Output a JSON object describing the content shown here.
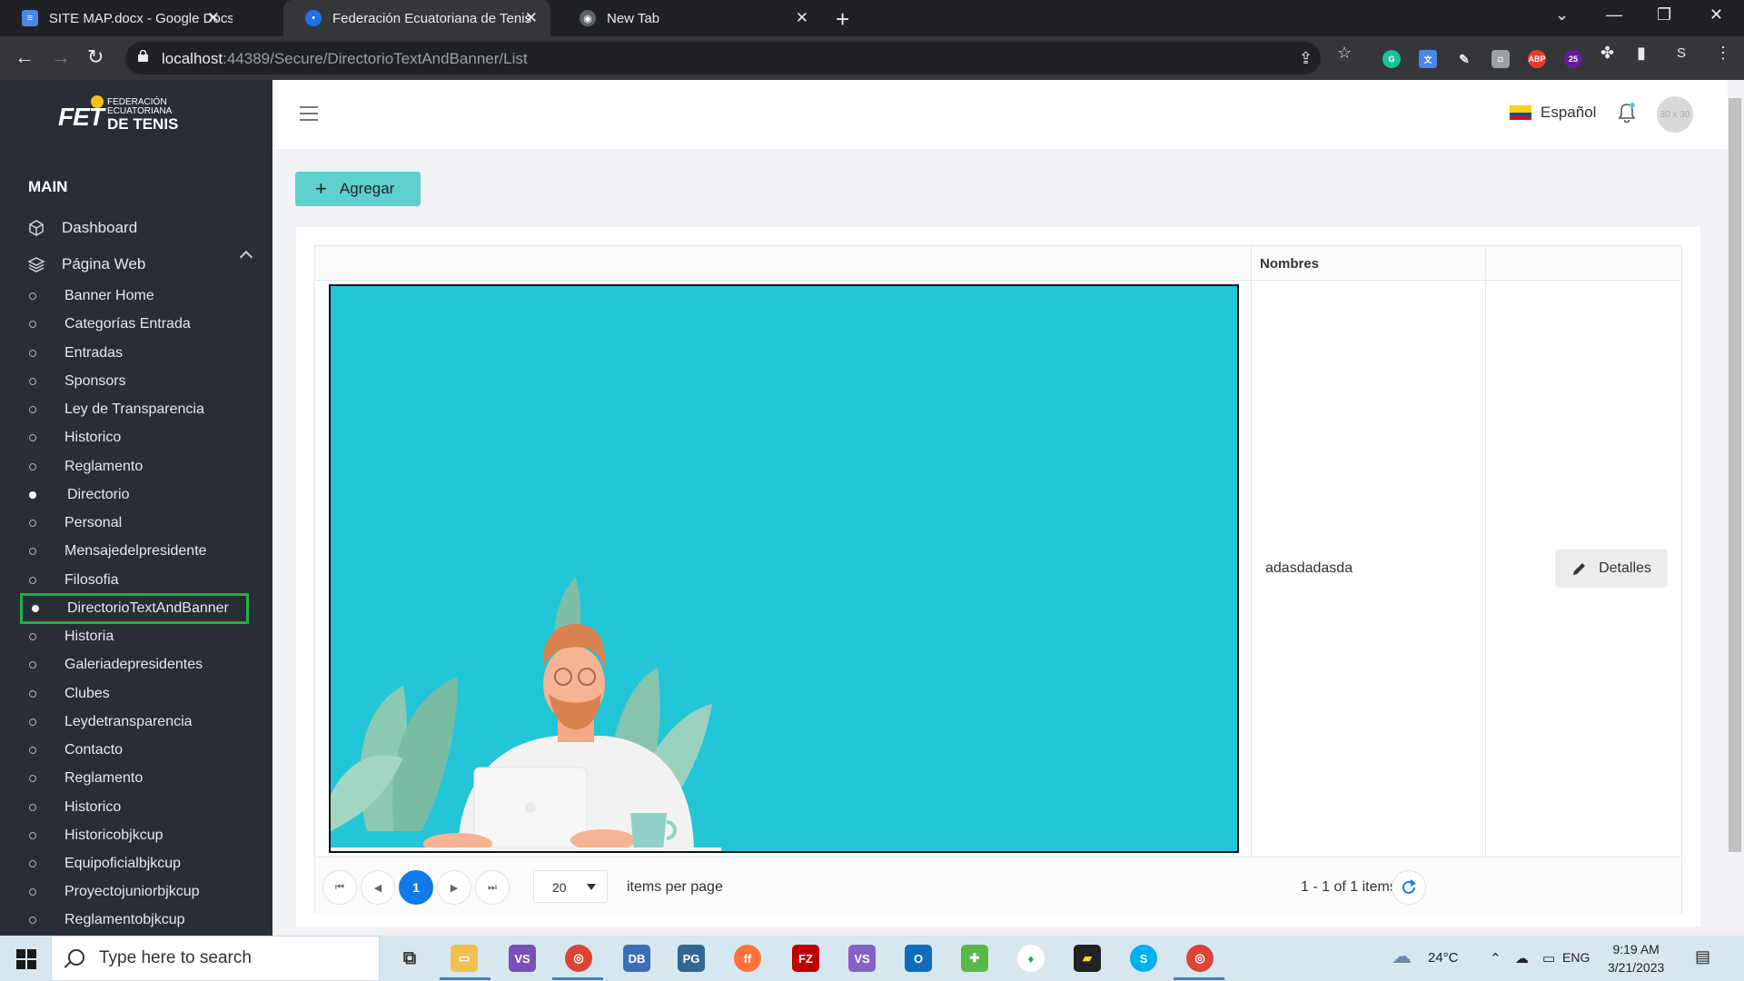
{
  "browser": {
    "tabs": [
      {
        "title": "SITE MAP.docx - Google Docs",
        "icon": "google-docs-icon"
      },
      {
        "title": "Federación Ecuatoriana de Tenis",
        "icon": "site-favicon"
      },
      {
        "title": "New Tab",
        "icon": "chrome-icon"
      }
    ],
    "url_host": "localhost",
    "url_path": ":44389/Secure/DirectorioTextAndBanner/List",
    "ext_badge": "25",
    "profile_letter": "S"
  },
  "logo": {
    "brand": "FET",
    "line1": "FEDERACIÓN",
    "line2": "ECUATORIANA",
    "line3": "DE TENIS"
  },
  "sidebar": {
    "heading": "MAIN",
    "main_items": [
      {
        "label": "Dashboard",
        "icon": "cube-icon"
      },
      {
        "label": "Página Web",
        "icon": "layers-icon"
      }
    ],
    "sub_items": [
      {
        "label": "Banner Home",
        "active": false
      },
      {
        "label": "Categorías Entrada",
        "active": false
      },
      {
        "label": "Entradas",
        "active": false
      },
      {
        "label": "Sponsors",
        "active": false
      },
      {
        "label": "Ley de Transparencia",
        "active": false
      },
      {
        "label": "Historico",
        "active": false
      },
      {
        "label": "Reglamento",
        "active": false
      },
      {
        "label": "Directorio",
        "active": true
      },
      {
        "label": "Personal",
        "active": false
      },
      {
        "label": "Mensajedelpresidente",
        "active": false
      },
      {
        "label": "Filosofia",
        "active": false
      },
      {
        "label": "DirectorioTextAndBanner",
        "active": true,
        "highlighted": true
      },
      {
        "label": "Historia",
        "active": false
      },
      {
        "label": "Galeriadepresidentes",
        "active": false
      },
      {
        "label": "Clubes",
        "active": false
      },
      {
        "label": "Leydetransparencia",
        "active": false
      },
      {
        "label": "Contacto",
        "active": false
      },
      {
        "label": "Reglamento",
        "active": false
      },
      {
        "label": "Historico",
        "active": false
      },
      {
        "label": "Historicobjkcup",
        "active": false
      },
      {
        "label": "Equipoficialbjkcup",
        "active": false
      },
      {
        "label": "Proyectojuniorbjkcup",
        "active": false
      },
      {
        "label": "Reglamentobjkcup",
        "active": false
      }
    ]
  },
  "header": {
    "language": "Español",
    "avatar_placeholder": "30 x 30"
  },
  "content": {
    "add_button": "Agregar",
    "table": {
      "columns": [
        "",
        "Nombres",
        ""
      ],
      "rows": [
        {
          "name": "adasdadasda",
          "action": "Detalles"
        }
      ]
    },
    "pager": {
      "current_page": "1",
      "page_size": "20",
      "items_per_page_label": "items per page",
      "info": "1 - 1 of 1 items"
    }
  },
  "taskbar": {
    "search_placeholder": "Type here to search",
    "weather": "24°C",
    "lang": "ENG",
    "time": "9:19 AM",
    "date": "3/21/2023"
  },
  "colors": {
    "sidebar_bg": "#282d36",
    "accent_teal": "#5ed0d0",
    "banner_cyan": "#22c6d7",
    "page_btn": "#1479e8",
    "highlight_green": "#1fb141"
  }
}
